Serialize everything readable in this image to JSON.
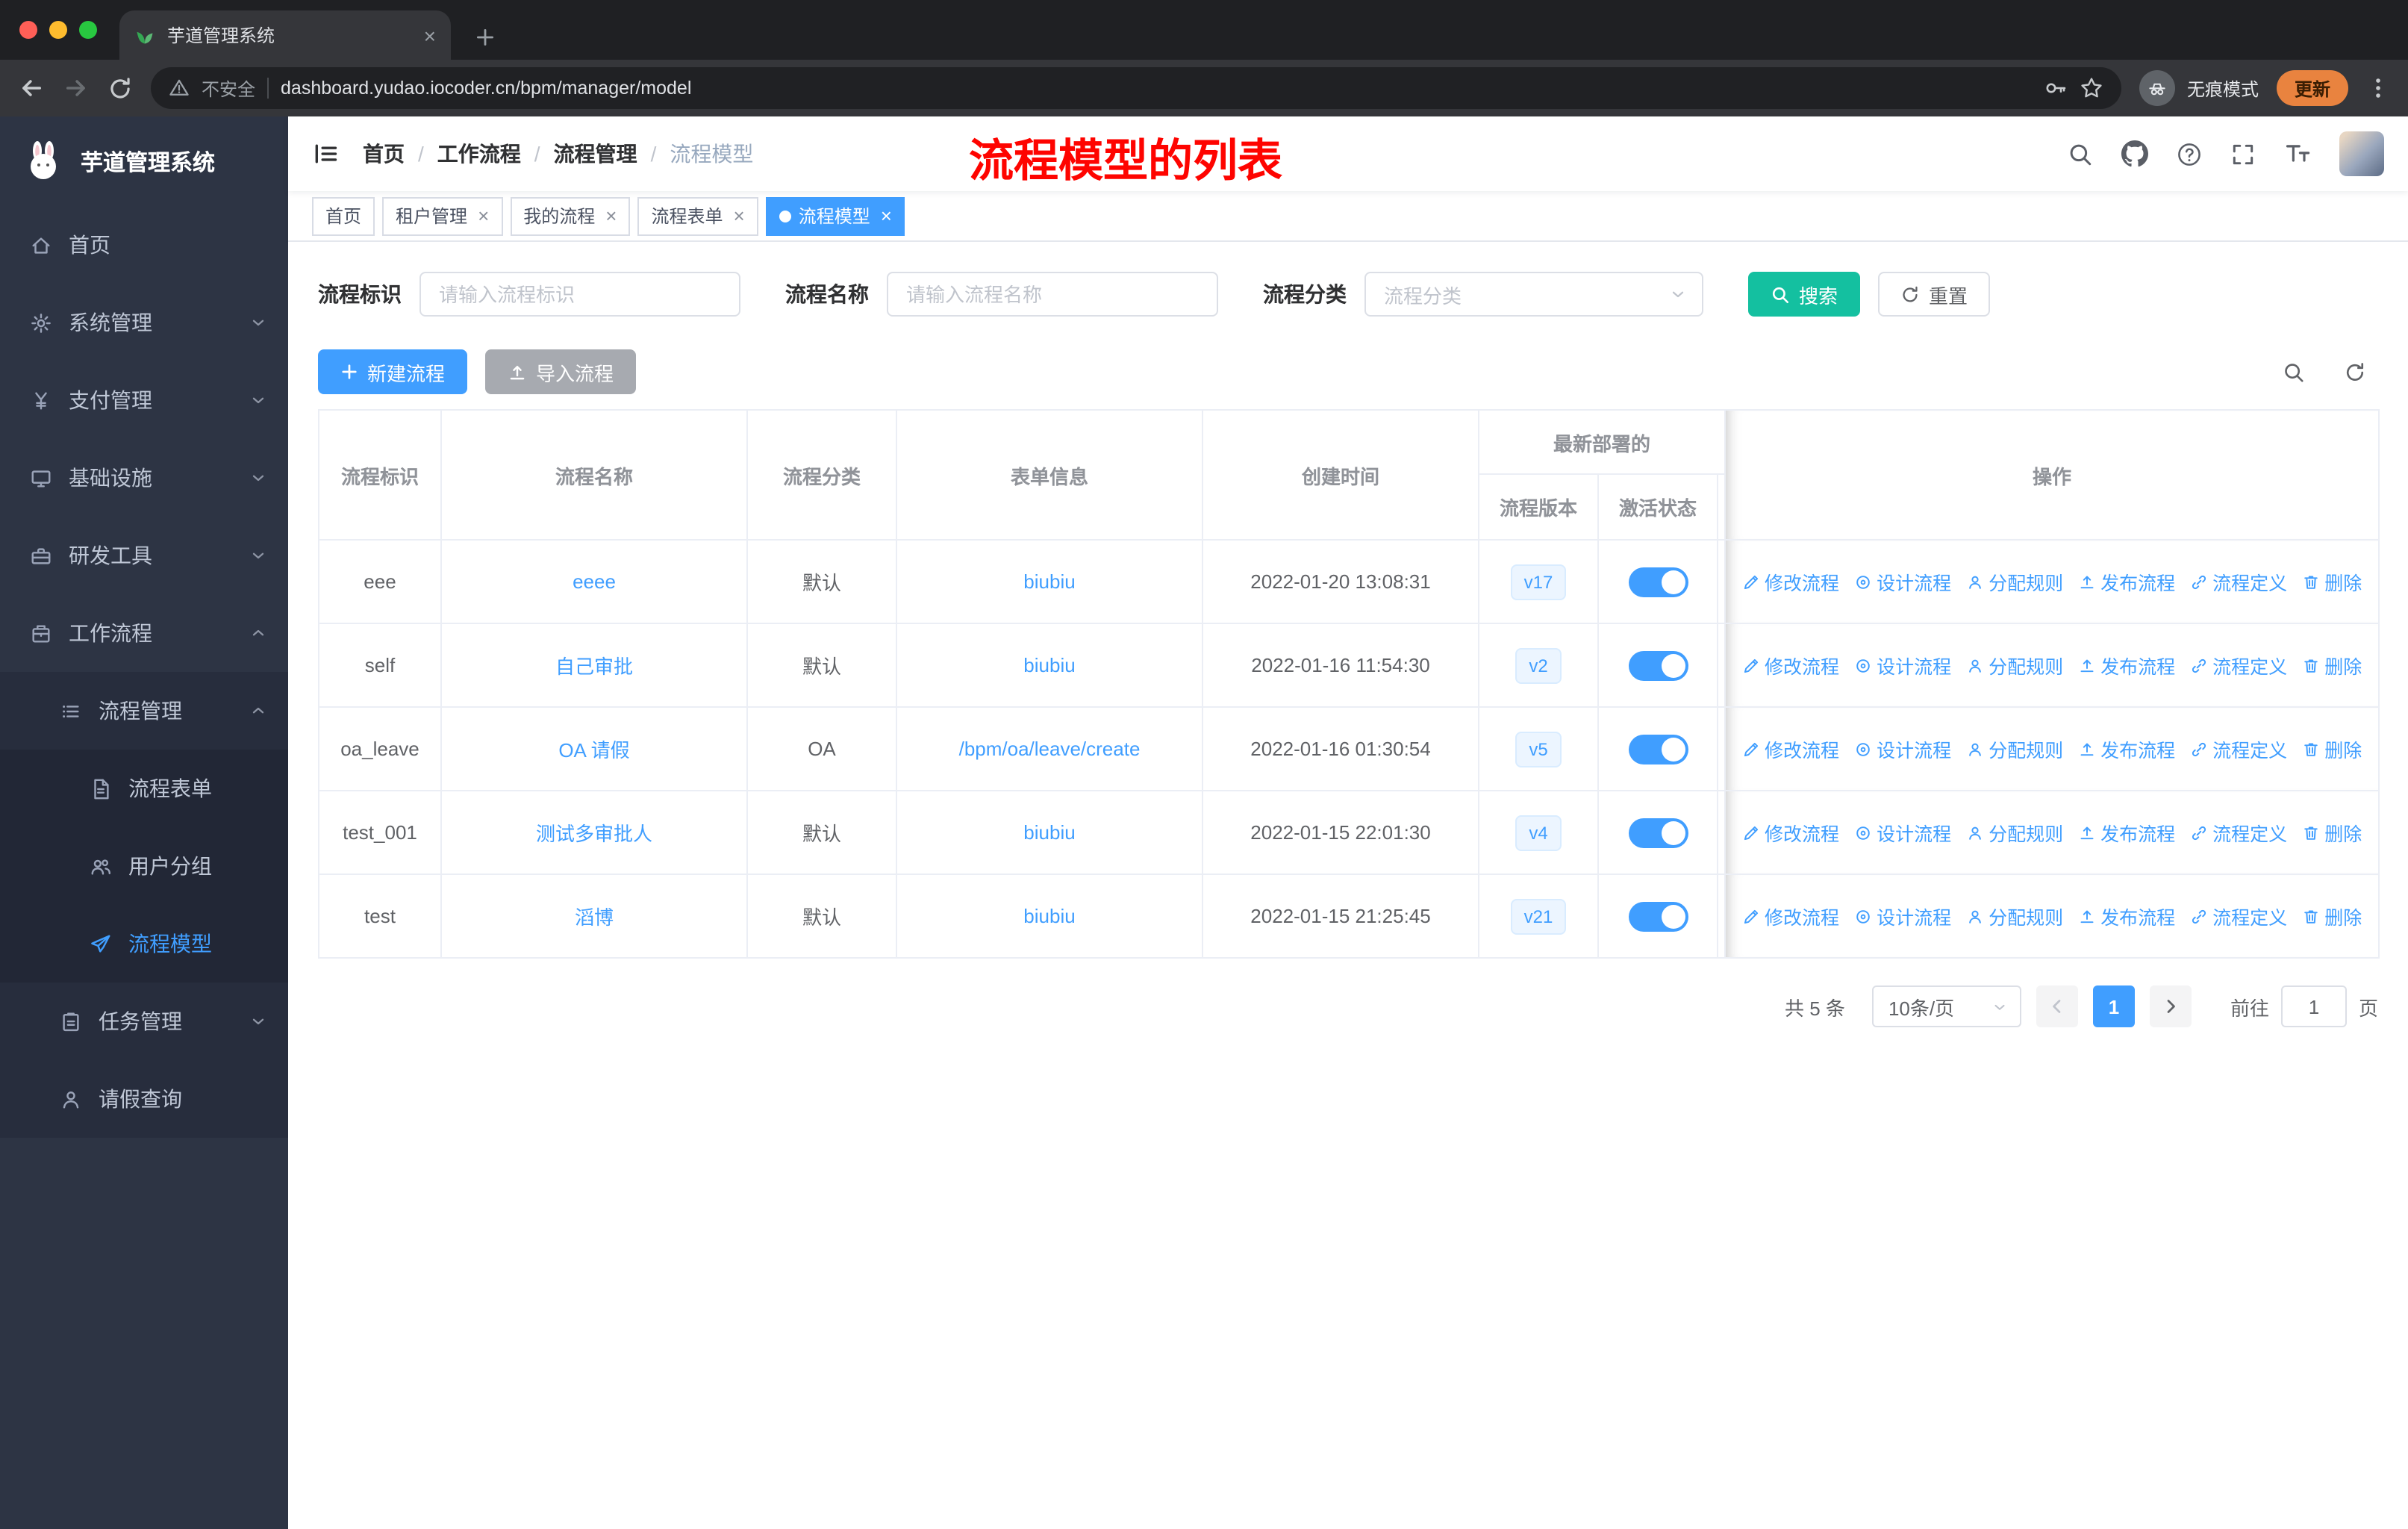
{
  "browser": {
    "tab_title": "芋道管理系统",
    "security_label": "不安全",
    "url": "dashboard.yudao.iocoder.cn/bpm/manager/model",
    "incognito_label": "无痕模式",
    "update_label": "更新"
  },
  "sidebar": {
    "app_title": "芋道管理系统",
    "menu": [
      {
        "label": "首页",
        "icon": "home-icon",
        "level": 0
      },
      {
        "label": "系统管理",
        "icon": "gear-icon",
        "level": 0,
        "arrow": "down"
      },
      {
        "label": "支付管理",
        "icon": "yen-icon",
        "level": 0,
        "arrow": "down"
      },
      {
        "label": "基础设施",
        "icon": "monitor-icon",
        "level": 0,
        "arrow": "down"
      },
      {
        "label": "研发工具",
        "icon": "toolbox-icon",
        "level": 0,
        "arrow": "down"
      },
      {
        "label": "工作流程",
        "icon": "briefcase-icon",
        "level": 0,
        "arrow": "up"
      },
      {
        "label": "流程管理",
        "icon": "list-icon",
        "level": 1,
        "arrow": "up"
      },
      {
        "label": "流程表单",
        "icon": "document-icon",
        "level": 2
      },
      {
        "label": "用户分组",
        "icon": "users-icon",
        "level": 2
      },
      {
        "label": "流程模型",
        "icon": "paper-plane-icon",
        "level": 2,
        "active": true
      },
      {
        "label": "任务管理",
        "icon": "clipboard-icon",
        "level": 1,
        "arrow": "down"
      },
      {
        "label": "请假查询",
        "icon": "user-icon",
        "level": 1
      }
    ]
  },
  "navbar": {
    "breadcrumb": [
      "首页",
      "工作流程",
      "流程管理",
      "流程模型"
    ],
    "annotation": "流程模型的列表"
  },
  "tags": [
    {
      "label": "首页",
      "closable": false,
      "active": false
    },
    {
      "label": "租户管理",
      "closable": true,
      "active": false
    },
    {
      "label": "我的流程",
      "closable": true,
      "active": false
    },
    {
      "label": "流程表单",
      "closable": true,
      "active": false
    },
    {
      "label": "流程模型",
      "closable": true,
      "active": true
    }
  ],
  "filters": {
    "key_label": "流程标识",
    "key_placeholder": "请输入流程标识",
    "name_label": "流程名称",
    "name_placeholder": "请输入流程名称",
    "category_label": "流程分类",
    "category_placeholder": "流程分类",
    "search_label": "搜索",
    "reset_label": "重置"
  },
  "toolbar": {
    "create_label": "新建流程",
    "import_label": "导入流程"
  },
  "table": {
    "headers": {
      "key": "流程标识",
      "name": "流程名称",
      "category": "流程分类",
      "form": "表单信息",
      "created": "创建时间",
      "group": "最新部署的",
      "version": "流程版本",
      "active": "激活状态",
      "ops": "操作"
    },
    "actions": [
      {
        "name": "edit",
        "label": "修改流程",
        "icon": "edit-icon"
      },
      {
        "name": "design",
        "label": "设计流程",
        "icon": "design-icon"
      },
      {
        "name": "assign",
        "label": "分配规则",
        "icon": "assign-icon"
      },
      {
        "name": "publish",
        "label": "发布流程",
        "icon": "publish-icon"
      },
      {
        "name": "definition",
        "label": "流程定义",
        "icon": "definition-icon"
      },
      {
        "name": "delete",
        "label": "删除",
        "icon": "delete-icon"
      }
    ],
    "rows": [
      {
        "key": "eee",
        "name": "eeee",
        "category": "默认",
        "form": "biubiu",
        "created": "2022-01-20 13:08:31",
        "version": "v17",
        "active": true
      },
      {
        "key": "self",
        "name": "自己审批",
        "category": "默认",
        "form": "biubiu",
        "created": "2022-01-16 11:54:30",
        "version": "v2",
        "active": true
      },
      {
        "key": "oa_leave",
        "name": "OA 请假",
        "category": "OA",
        "form": "/bpm/oa/leave/create",
        "created": "2022-01-16 01:30:54",
        "version": "v5",
        "active": true
      },
      {
        "key": "test_001",
        "name": "测试多审批人",
        "category": "默认",
        "form": "biubiu",
        "created": "2022-01-15 22:01:30",
        "version": "v4",
        "active": true
      },
      {
        "key": "test",
        "name": "滔博",
        "category": "默认",
        "form": "biubiu",
        "created": "2022-01-15 21:25:45",
        "version": "v21",
        "active": true
      }
    ]
  },
  "pagination": {
    "total": "共 5 条",
    "page_size": "10条/页",
    "current_page": "1",
    "goto_label": "前往",
    "goto_value": "1",
    "page_unit": "页"
  },
  "colors": {
    "primary": "#409eff",
    "search_button": "#14c0a0",
    "import_button": "#a7aab0",
    "annotation_red": "#fe0400",
    "version_tag_bg": "#ecf5ff",
    "sidebar_bg": "#2d3444"
  }
}
